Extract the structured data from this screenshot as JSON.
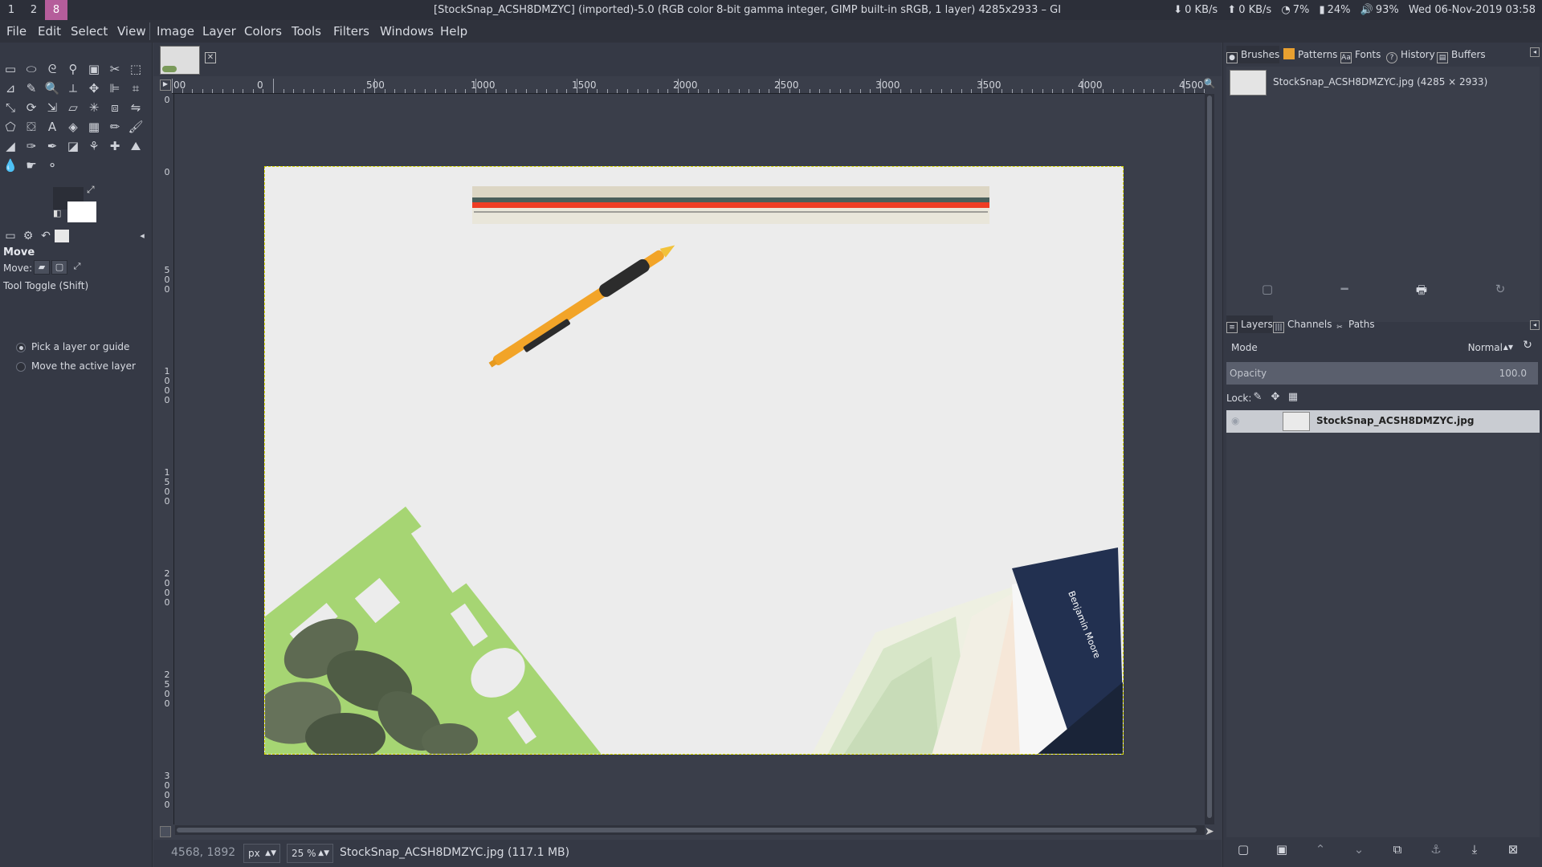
{
  "topbar": {
    "workspaces": [
      "1",
      "2",
      "8"
    ],
    "title": "[StockSnap_ACSH8DMZYC] (imported)-5.0 (RGB color 8-bit gamma integer, GIMP built-in sRGB, 1 layer) 4285x2933 – GIMP",
    "net_down": "0 KB/s",
    "net_up": "0 KB/s",
    "cpu": "7%",
    "battery": "24%",
    "volume": "93%",
    "datetime": "Wed 06-Nov-2019  03:58"
  },
  "menubar": [
    "File",
    "Edit",
    "Select",
    "View",
    "Image",
    "Layer",
    "Colors",
    "Tools",
    "Filters",
    "Windows",
    "Help"
  ],
  "tool_options": {
    "title": "Move",
    "move_label": "Move:",
    "toggle_label": "Tool Toggle  (Shift)",
    "radio_options": [
      "Pick a layer or guide",
      "Move the active layer"
    ],
    "selected_option": 0
  },
  "rulers": {
    "h_labels": [
      "00",
      "0",
      "500",
      "1000",
      "1500",
      "2000",
      "2500",
      "3000",
      "3500",
      "4000",
      "4500"
    ],
    "v_labels": [
      "0",
      "0",
      "500",
      "1000",
      "1500",
      "2000",
      "2500",
      "3000"
    ]
  },
  "status": {
    "coords": "4568, 1892",
    "unit": "px",
    "zoom": "25 %",
    "text": "StockSnap_ACSH8DMZYC.jpg (117.1 MB)"
  },
  "dock": {
    "top_tabs": [
      "Brushes",
      "Patterns",
      "Fonts",
      "History",
      "Buffers"
    ],
    "image_entry": "StockSnap_ACSH8DMZYC.jpg (4285 × 2933)",
    "layer_tabs": [
      "Layers",
      "Channels",
      "Paths"
    ],
    "mode_label": "Mode",
    "mode_value": "Normal",
    "opacity_label": "Opacity",
    "opacity_value": "100.0",
    "lock_label": "Lock:",
    "layer_name": "StockSnap_ACSH8DMZYC.jpg"
  },
  "photo": {
    "brand_text": "Benjamin Moore"
  },
  "colors": {
    "accent_workspace": "#b55d9b",
    "canvas_bg": "#3a3e4a",
    "selection_outline": "#e0e000"
  }
}
